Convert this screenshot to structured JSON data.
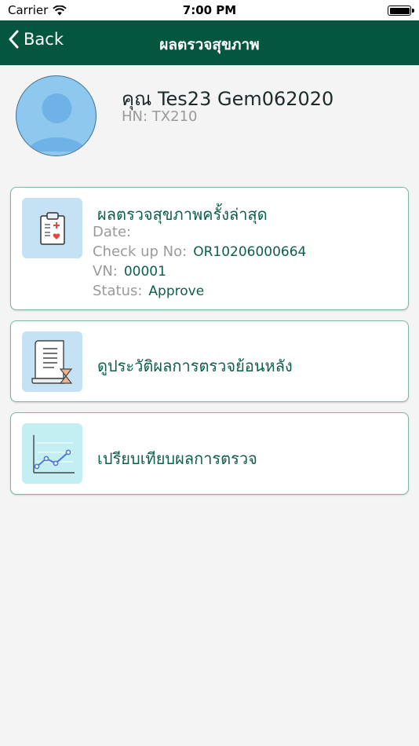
{
  "status_bar": {
    "carrier": "Carrier",
    "time": "7:00 PM"
  },
  "nav": {
    "back_label": "Back",
    "title": "ผลตรวจสุขภาพ"
  },
  "profile": {
    "name": "คุณ Tes23 Gem062020",
    "hn": "HN: TX210"
  },
  "latest_card": {
    "title": "ผลตรวจสุขภาพครั้งล่าสุด",
    "date_label": "Date:",
    "date_value": "",
    "checkup_label": "Check up No:",
    "checkup_value": "OR10206000664",
    "vn_label": "VN:",
    "vn_value": "00001",
    "status_label": "Status:",
    "status_value": "Approve",
    "icon": "clipboard-medical-icon"
  },
  "history_card": {
    "label": "ดูประวัติผลการตรวจย้อนหลัง",
    "icon": "document-hourglass-icon"
  },
  "compare_card": {
    "label": "เปรียบเทียบผลการตรวจ",
    "icon": "line-chart-icon"
  },
  "colors": {
    "nav_bg": "#05563f",
    "accent_text": "#0d5e4b",
    "card_border": "#7fb7a2",
    "avatar_bg": "#8ec8ef"
  }
}
